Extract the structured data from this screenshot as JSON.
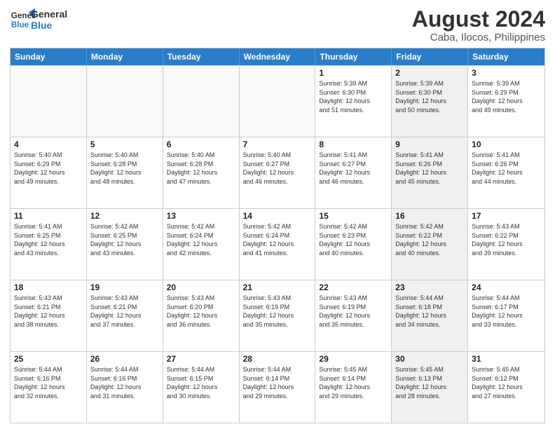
{
  "logo": {
    "line1": "General",
    "line2": "Blue"
  },
  "title": "August 2024",
  "location": "Caba, Ilocos, Philippines",
  "days_of_week": [
    "Sunday",
    "Monday",
    "Tuesday",
    "Wednesday",
    "Thursday",
    "Friday",
    "Saturday"
  ],
  "weeks": [
    [
      {
        "day": "",
        "info": "",
        "empty": true
      },
      {
        "day": "",
        "info": "",
        "empty": true
      },
      {
        "day": "",
        "info": "",
        "empty": true
      },
      {
        "day": "",
        "info": "",
        "empty": true
      },
      {
        "day": "1",
        "info": "Sunrise: 5:39 AM\nSunset: 6:30 PM\nDaylight: 12 hours\nand 51 minutes.",
        "shaded": false
      },
      {
        "day": "2",
        "info": "Sunrise: 5:39 AM\nSunset: 6:30 PM\nDaylight: 12 hours\nand 50 minutes.",
        "shaded": true
      },
      {
        "day": "3",
        "info": "Sunrise: 5:39 AM\nSunset: 6:29 PM\nDaylight: 12 hours\nand 49 minutes.",
        "shaded": false
      }
    ],
    [
      {
        "day": "4",
        "info": "Sunrise: 5:40 AM\nSunset: 6:29 PM\nDaylight: 12 hours\nand 49 minutes.",
        "shaded": false
      },
      {
        "day": "5",
        "info": "Sunrise: 5:40 AM\nSunset: 6:28 PM\nDaylight: 12 hours\nand 48 minutes.",
        "shaded": false
      },
      {
        "day": "6",
        "info": "Sunrise: 5:40 AM\nSunset: 6:28 PM\nDaylight: 12 hours\nand 47 minutes.",
        "shaded": false
      },
      {
        "day": "7",
        "info": "Sunrise: 5:40 AM\nSunset: 6:27 PM\nDaylight: 12 hours\nand 46 minutes.",
        "shaded": false
      },
      {
        "day": "8",
        "info": "Sunrise: 5:41 AM\nSunset: 6:27 PM\nDaylight: 12 hours\nand 46 minutes.",
        "shaded": false
      },
      {
        "day": "9",
        "info": "Sunrise: 5:41 AM\nSunset: 6:26 PM\nDaylight: 12 hours\nand 45 minutes.",
        "shaded": true
      },
      {
        "day": "10",
        "info": "Sunrise: 5:41 AM\nSunset: 6:26 PM\nDaylight: 12 hours\nand 44 minutes.",
        "shaded": false
      }
    ],
    [
      {
        "day": "11",
        "info": "Sunrise: 5:41 AM\nSunset: 6:25 PM\nDaylight: 12 hours\nand 43 minutes.",
        "shaded": false
      },
      {
        "day": "12",
        "info": "Sunrise: 5:42 AM\nSunset: 6:25 PM\nDaylight: 12 hours\nand 43 minutes.",
        "shaded": false
      },
      {
        "day": "13",
        "info": "Sunrise: 5:42 AM\nSunset: 6:24 PM\nDaylight: 12 hours\nand 42 minutes.",
        "shaded": false
      },
      {
        "day": "14",
        "info": "Sunrise: 5:42 AM\nSunset: 6:24 PM\nDaylight: 12 hours\nand 41 minutes.",
        "shaded": false
      },
      {
        "day": "15",
        "info": "Sunrise: 5:42 AM\nSunset: 6:23 PM\nDaylight: 12 hours\nand 40 minutes.",
        "shaded": false
      },
      {
        "day": "16",
        "info": "Sunrise: 5:42 AM\nSunset: 6:22 PM\nDaylight: 12 hours\nand 40 minutes.",
        "shaded": true
      },
      {
        "day": "17",
        "info": "Sunrise: 5:43 AM\nSunset: 6:22 PM\nDaylight: 12 hours\nand 39 minutes.",
        "shaded": false
      }
    ],
    [
      {
        "day": "18",
        "info": "Sunrise: 5:43 AM\nSunset: 6:21 PM\nDaylight: 12 hours\nand 38 minutes.",
        "shaded": false
      },
      {
        "day": "19",
        "info": "Sunrise: 5:43 AM\nSunset: 6:21 PM\nDaylight: 12 hours\nand 37 minutes.",
        "shaded": false
      },
      {
        "day": "20",
        "info": "Sunrise: 5:43 AM\nSunset: 6:20 PM\nDaylight: 12 hours\nand 36 minutes.",
        "shaded": false
      },
      {
        "day": "21",
        "info": "Sunrise: 5:43 AM\nSunset: 6:19 PM\nDaylight: 12 hours\nand 35 minutes.",
        "shaded": false
      },
      {
        "day": "22",
        "info": "Sunrise: 5:43 AM\nSunset: 6:19 PM\nDaylight: 12 hours\nand 35 minutes.",
        "shaded": false
      },
      {
        "day": "23",
        "info": "Sunrise: 5:44 AM\nSunset: 6:18 PM\nDaylight: 12 hours\nand 34 minutes.",
        "shaded": true
      },
      {
        "day": "24",
        "info": "Sunrise: 5:44 AM\nSunset: 6:17 PM\nDaylight: 12 hours\nand 33 minutes.",
        "shaded": false
      }
    ],
    [
      {
        "day": "25",
        "info": "Sunrise: 5:44 AM\nSunset: 6:16 PM\nDaylight: 12 hours\nand 32 minutes.",
        "shaded": false
      },
      {
        "day": "26",
        "info": "Sunrise: 5:44 AM\nSunset: 6:16 PM\nDaylight: 12 hours\nand 31 minutes.",
        "shaded": false
      },
      {
        "day": "27",
        "info": "Sunrise: 5:44 AM\nSunset: 6:15 PM\nDaylight: 12 hours\nand 30 minutes.",
        "shaded": false
      },
      {
        "day": "28",
        "info": "Sunrise: 5:44 AM\nSunset: 6:14 PM\nDaylight: 12 hours\nand 29 minutes.",
        "shaded": false
      },
      {
        "day": "29",
        "info": "Sunrise: 5:45 AM\nSunset: 6:14 PM\nDaylight: 12 hours\nand 29 minutes.",
        "shaded": false
      },
      {
        "day": "30",
        "info": "Sunrise: 5:45 AM\nSunset: 6:13 PM\nDaylight: 12 hours\nand 28 minutes.",
        "shaded": true
      },
      {
        "day": "31",
        "info": "Sunrise: 5:45 AM\nSunset: 6:12 PM\nDaylight: 12 hours\nand 27 minutes.",
        "shaded": false
      }
    ]
  ]
}
